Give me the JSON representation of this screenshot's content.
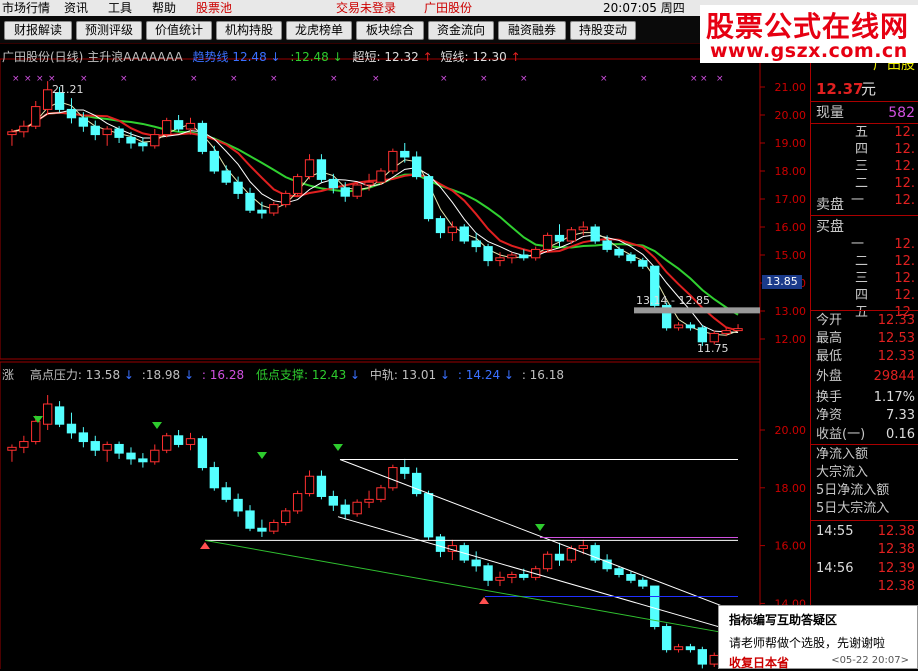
{
  "menu": {
    "market": "市场行情",
    "news": "资讯",
    "tools": "工具",
    "help": "帮助",
    "stock_pool": "股票池",
    "trade_status": "交易未登录",
    "stock_name": "广田股份",
    "time": "20:07:05 周四"
  },
  "toolbar": [
    "财报解读",
    "预测评级",
    "价值统计",
    "机构持股",
    "龙虎榜单",
    "板块综合",
    "资金流向",
    "融资融券",
    "持股变动"
  ],
  "logo": {
    "title": "股票公式在线网",
    "url": "www.gszx.com.cn"
  },
  "upper": {
    "title": "广田股份(日线)",
    "formula": "主升浪AAAAAAA",
    "l1": "趋势线",
    "v1": "12.48",
    "arrow1": "↓",
    "v2": ":12.48",
    "arrow2": "↓",
    "l3": "超短:",
    "v3": "12.32",
    "arrow3": "↑",
    "l4": "短线:",
    "v4": "12.30",
    "arrow4": "↑",
    "yaxis": [
      "21.00",
      "20.00",
      "19.00",
      "18.00",
      "17.00",
      "16.00",
      "15.00",
      "14.00",
      "13.00",
      "12.00"
    ],
    "current_price_tag": "13.85",
    "high_label": "21.21",
    "low_label": "11.75",
    "range_label": "13.14 - 12.85"
  },
  "lower": {
    "prefix": "涨",
    "l1": "高点压力:",
    "v1": "13.58",
    "a1": "↓",
    "v2": ":18.98",
    "a2": "↓",
    "v3": ": 16.28",
    "l4": "低点支撑:",
    "v4": "12.43",
    "a4": "↓",
    "l5": "中轨:",
    "v5": "13.01",
    "a5": "↓",
    "v6": ": 14.24",
    "a6": "↓",
    "v7": ": 16.18",
    "yaxis": [
      "20.00",
      "18.00",
      "16.00",
      "14.00"
    ]
  },
  "panel": {
    "name": "广田股",
    "price": "12.37",
    "unit": "元",
    "vol_label": "现量",
    "vol": "582",
    "sell_levels": [
      "五",
      "四",
      "三",
      "二",
      "一"
    ],
    "sell_prices": [
      "12.",
      "12.",
      "12.",
      "12.",
      "12."
    ],
    "sell_label": "卖盘",
    "buy_label": "买盘",
    "buy_levels": [
      "一",
      "二",
      "三",
      "四",
      "五"
    ],
    "buy_prices": [
      "12.",
      "12.",
      "12.",
      "12.",
      "12."
    ],
    "stats": [
      [
        "今开",
        "12.33"
      ],
      [
        "最高",
        "12.53"
      ],
      [
        "最低",
        "12.33"
      ],
      [
        "外盘",
        "29844"
      ],
      [
        "换手",
        "1.17%"
      ],
      [
        "净资",
        "7.33"
      ],
      [
        "收益(一)",
        "0.16"
      ]
    ],
    "flows": [
      "净流入额",
      "大宗流入",
      "5日净流入额",
      "5日大宗流入"
    ],
    "ticks": [
      [
        "14:55",
        "12.38"
      ],
      [
        "",
        "12.38"
      ],
      [
        "14:56",
        "12.39"
      ],
      [
        "",
        "12.38"
      ]
    ]
  },
  "popup": {
    "title": "指标编写互助答疑区",
    "body": "请老师帮做个选股，先谢谢啦",
    "footer": "收复日本省",
    "date": "<05-22 20:07>"
  },
  "chart_data": {
    "type": "candlestick",
    "title": "广田股份(日线)",
    "ylim": [
      11.5,
      21.5
    ],
    "candles": [
      [
        19.3,
        19.5,
        18.9,
        19.4
      ],
      [
        19.4,
        19.8,
        19.2,
        19.6
      ],
      [
        19.6,
        20.5,
        19.5,
        20.3
      ],
      [
        20.2,
        21.21,
        20.0,
        20.9
      ],
      [
        20.8,
        21.0,
        20.1,
        20.2
      ],
      [
        20.2,
        20.6,
        19.7,
        19.9
      ],
      [
        19.9,
        20.1,
        19.4,
        19.6
      ],
      [
        19.6,
        19.8,
        19.1,
        19.3
      ],
      [
        19.3,
        19.6,
        18.9,
        19.5
      ],
      [
        19.5,
        19.6,
        19.0,
        19.2
      ],
      [
        19.2,
        19.4,
        18.8,
        19.0
      ],
      [
        19.0,
        19.2,
        18.7,
        18.9
      ],
      [
        18.9,
        19.5,
        18.8,
        19.3
      ],
      [
        19.3,
        19.9,
        19.2,
        19.8
      ],
      [
        19.8,
        20.0,
        19.4,
        19.5
      ],
      [
        19.5,
        19.9,
        19.3,
        19.7
      ],
      [
        19.7,
        19.8,
        18.6,
        18.7
      ],
      [
        18.7,
        18.9,
        17.9,
        18.0
      ],
      [
        18.0,
        18.2,
        17.5,
        17.6
      ],
      [
        17.6,
        17.8,
        17.0,
        17.2
      ],
      [
        17.2,
        17.4,
        16.5,
        16.6
      ],
      [
        16.6,
        16.9,
        16.3,
        16.5
      ],
      [
        16.5,
        16.9,
        16.4,
        16.8
      ],
      [
        16.8,
        17.3,
        16.7,
        17.2
      ],
      [
        17.2,
        17.9,
        17.1,
        17.8
      ],
      [
        17.8,
        18.6,
        17.7,
        18.4
      ],
      [
        18.4,
        18.6,
        17.6,
        17.7
      ],
      [
        17.7,
        17.9,
        17.2,
        17.4
      ],
      [
        17.4,
        17.6,
        16.9,
        17.1
      ],
      [
        17.1,
        17.6,
        17.0,
        17.5
      ],
      [
        17.5,
        17.9,
        17.3,
        17.6
      ],
      [
        17.6,
        18.1,
        17.5,
        18.0
      ],
      [
        18.0,
        18.8,
        17.9,
        18.7
      ],
      [
        18.7,
        19.0,
        18.3,
        18.5
      ],
      [
        18.5,
        18.7,
        17.7,
        17.8
      ],
      [
        17.8,
        17.9,
        16.2,
        16.3
      ],
      [
        16.3,
        16.4,
        15.6,
        15.8
      ],
      [
        15.8,
        16.2,
        15.5,
        16.0
      ],
      [
        16.0,
        16.1,
        15.4,
        15.5
      ],
      [
        15.5,
        15.8,
        15.1,
        15.3
      ],
      [
        15.3,
        15.4,
        14.6,
        14.8
      ],
      [
        14.8,
        15.1,
        14.6,
        14.9
      ],
      [
        14.9,
        15.1,
        14.7,
        15.0
      ],
      [
        15.0,
        15.2,
        14.8,
        14.9
      ],
      [
        14.9,
        15.3,
        14.8,
        15.2
      ],
      [
        15.2,
        15.8,
        15.1,
        15.7
      ],
      [
        15.7,
        16.1,
        15.3,
        15.5
      ],
      [
        15.5,
        16.0,
        15.4,
        15.9
      ],
      [
        15.9,
        16.2,
        15.7,
        16.0
      ],
      [
        16.0,
        16.1,
        15.4,
        15.5
      ],
      [
        15.5,
        15.7,
        15.1,
        15.2
      ],
      [
        15.2,
        15.3,
        14.9,
        15.0
      ],
      [
        15.0,
        15.1,
        14.7,
        14.8
      ],
      [
        14.8,
        14.9,
        14.5,
        14.6
      ],
      [
        14.6,
        14.6,
        13.1,
        13.2
      ],
      [
        13.2,
        13.3,
        12.3,
        12.4
      ],
      [
        12.4,
        12.6,
        12.3,
        12.5
      ],
      [
        12.5,
        12.6,
        12.3,
        12.4
      ],
      [
        12.4,
        12.5,
        11.75,
        11.9
      ],
      [
        11.9,
        12.3,
        11.8,
        12.2
      ],
      [
        12.2,
        12.4,
        12.1,
        12.3
      ],
      [
        12.3,
        12.53,
        12.33,
        12.37
      ]
    ]
  }
}
